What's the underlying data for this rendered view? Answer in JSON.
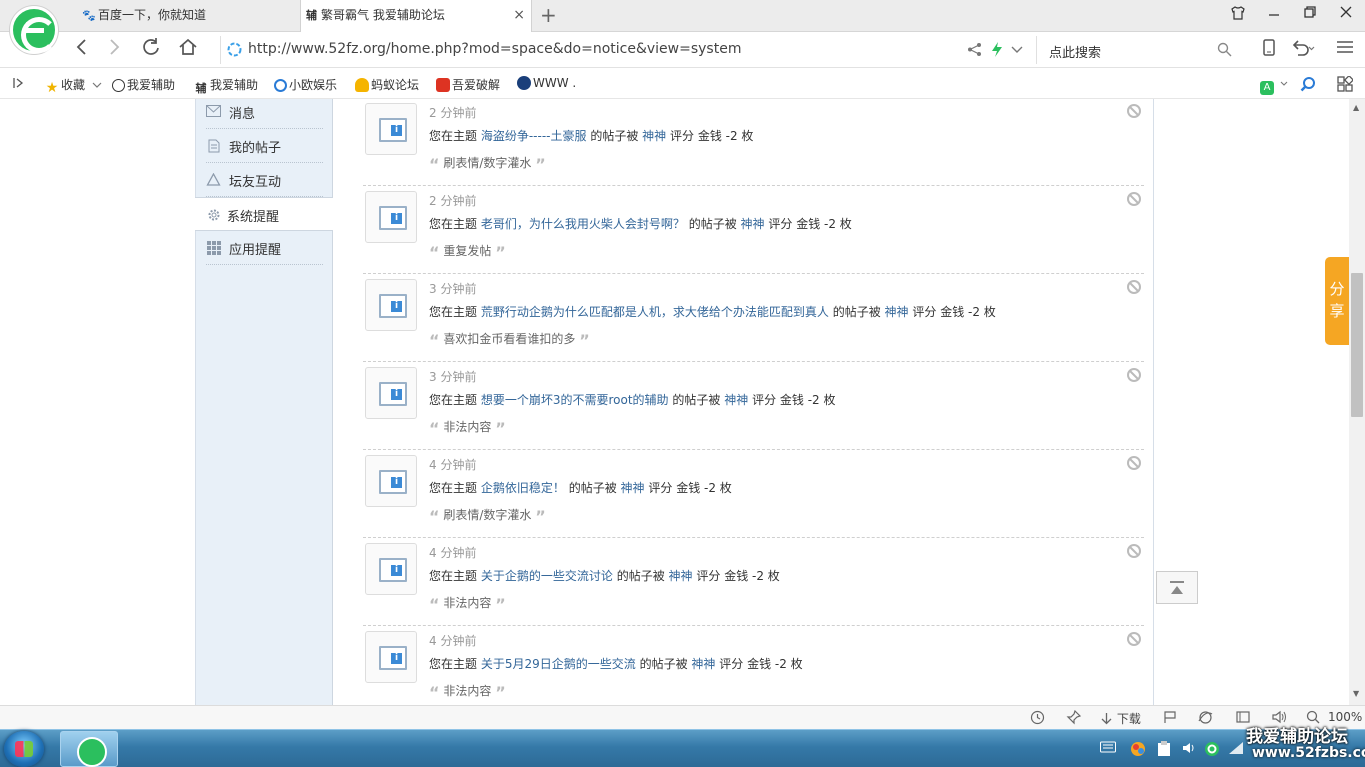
{
  "browser": {
    "tabs": [
      {
        "label": "百度一下，你就知道",
        "favicon": "baidu-paw-icon"
      },
      {
        "label": "繁哥霸气 我爱辅助论坛",
        "favicon": "fu-icon",
        "favicon_text": "辅",
        "close": "×"
      }
    ],
    "new_tab": "+",
    "url": "http://www.52fz.org/home.php?mod=space&do=notice&view=system",
    "search_placeholder": "点此搜索"
  },
  "bookmarks": [
    {
      "label": "收藏",
      "icon": "star-icon"
    },
    {
      "label": "我爱辅助",
      "icon": "soccer-icon"
    },
    {
      "label": "我爱辅助",
      "icon": "fu-icon"
    },
    {
      "label": "小欧娱乐",
      "icon": "circle-q-icon"
    },
    {
      "label": "蚂蚁论坛",
      "icon": "ant-icon"
    },
    {
      "label": "吾爱破解",
      "icon": "52pojie-icon"
    },
    {
      "label": "WWW .",
      "icon": "globe-icon"
    }
  ],
  "sidebar": {
    "items": [
      {
        "label": "消息",
        "icon": "envelope-icon"
      },
      {
        "label": "我的帖子",
        "icon": "document-icon"
      },
      {
        "label": "坛友互动",
        "icon": "recycle-icon"
      },
      {
        "label": "系统提醒",
        "icon": "gear-icon",
        "active": true
      },
      {
        "label": "应用提醒",
        "icon": "grid-icon"
      }
    ]
  },
  "notice_text": {
    "prefix": "您在主题",
    "mid": "的帖子被",
    "user": "神神",
    "suffix": "评分 金钱 -2 枚"
  },
  "notices": [
    {
      "time": "2 分钟前",
      "topic": "海盗纷争-----土豪服",
      "reason": "刷表情/数字灌水"
    },
    {
      "time": "2 分钟前",
      "topic": "老哥们，为什么我用火柴人会封号啊？",
      "reason": "重复发帖"
    },
    {
      "time": "3 分钟前",
      "topic": "荒野行动企鹅为什么匹配都是人机，求大佬给个办法能匹配到真人",
      "reason": "喜欢扣金币看看谁扣的多"
    },
    {
      "time": "3 分钟前",
      "topic": "想要一个崩坏3的不需要root的辅助",
      "reason": "非法内容"
    },
    {
      "time": "4 分钟前",
      "topic": "企鹅依旧稳定！",
      "reason": "刷表情/数字灌水"
    },
    {
      "time": "4 分钟前",
      "topic": "关于企鹅的一些交流讨论",
      "reason": "非法内容"
    },
    {
      "time": "4 分钟前",
      "topic": "关于5月29日企鹅的一些交流",
      "reason": "非法内容"
    }
  ],
  "share_label": "分享",
  "share_chars": [
    "分",
    "享"
  ],
  "statusbar": {
    "download": "下载",
    "zoom": "100%"
  },
  "watermark": {
    "line1": "我爱辅助论坛",
    "line2": "www.52fzbs.com"
  },
  "colors": {
    "link": "#336699",
    "share": "#f5a623",
    "sidebar_bg": "#e8f0f8"
  }
}
